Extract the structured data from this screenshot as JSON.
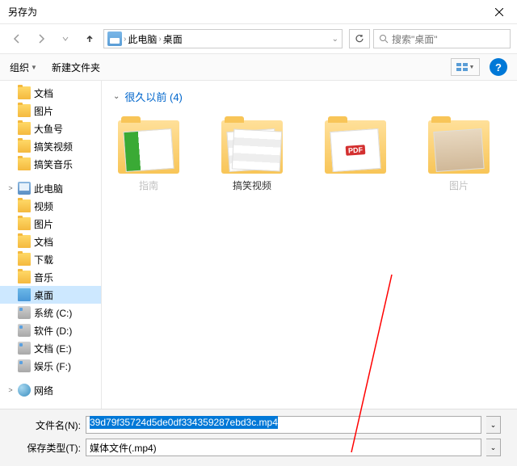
{
  "window": {
    "title": "另存为"
  },
  "nav": {
    "breadcrumb": {
      "root": "此电脑",
      "current": "桌面"
    },
    "search_placeholder": "搜索\"桌面\""
  },
  "toolbar": {
    "organize": "组织",
    "new_folder": "新建文件夹"
  },
  "sidebar": {
    "items": [
      {
        "label": "文档",
        "icon": "folder",
        "child": true
      },
      {
        "label": "图片",
        "icon": "folder",
        "child": true
      },
      {
        "label": "大鱼号",
        "icon": "folder",
        "child": true
      },
      {
        "label": "搞笑视频",
        "icon": "folder",
        "child": true
      },
      {
        "label": "搞笑音乐",
        "icon": "folder",
        "child": true
      },
      {
        "label": "此电脑",
        "icon": "pc",
        "child": false,
        "expandable": true
      },
      {
        "label": "视频",
        "icon": "folder",
        "child": true
      },
      {
        "label": "图片",
        "icon": "folder",
        "child": true
      },
      {
        "label": "文档",
        "icon": "folder",
        "child": true
      },
      {
        "label": "下载",
        "icon": "folder",
        "child": true
      },
      {
        "label": "音乐",
        "icon": "folder",
        "child": true
      },
      {
        "label": "桌面",
        "icon": "desktop",
        "child": true,
        "selected": true
      },
      {
        "label": "系统 (C:)",
        "icon": "drive",
        "child": true
      },
      {
        "label": "软件 (D:)",
        "icon": "drive",
        "child": true
      },
      {
        "label": "文档 (E:)",
        "icon": "drive",
        "child": true
      },
      {
        "label": "娱乐 (F:)",
        "icon": "drive",
        "child": true
      },
      {
        "label": "网络",
        "icon": "net",
        "child": false,
        "expandable": true
      }
    ]
  },
  "content": {
    "group_label": "很久以前 (4)",
    "items": [
      {
        "label": "指南"
      },
      {
        "label": "搞笑视频"
      },
      {
        "label": ""
      },
      {
        "label": "图片"
      }
    ]
  },
  "bottom": {
    "filename_label": "文件名(N):",
    "filename_value": "39d79f35724d5de0df334359287ebd3c.mp4",
    "type_label": "保存类型(T):",
    "type_value": "媒体文件(.mp4)"
  }
}
